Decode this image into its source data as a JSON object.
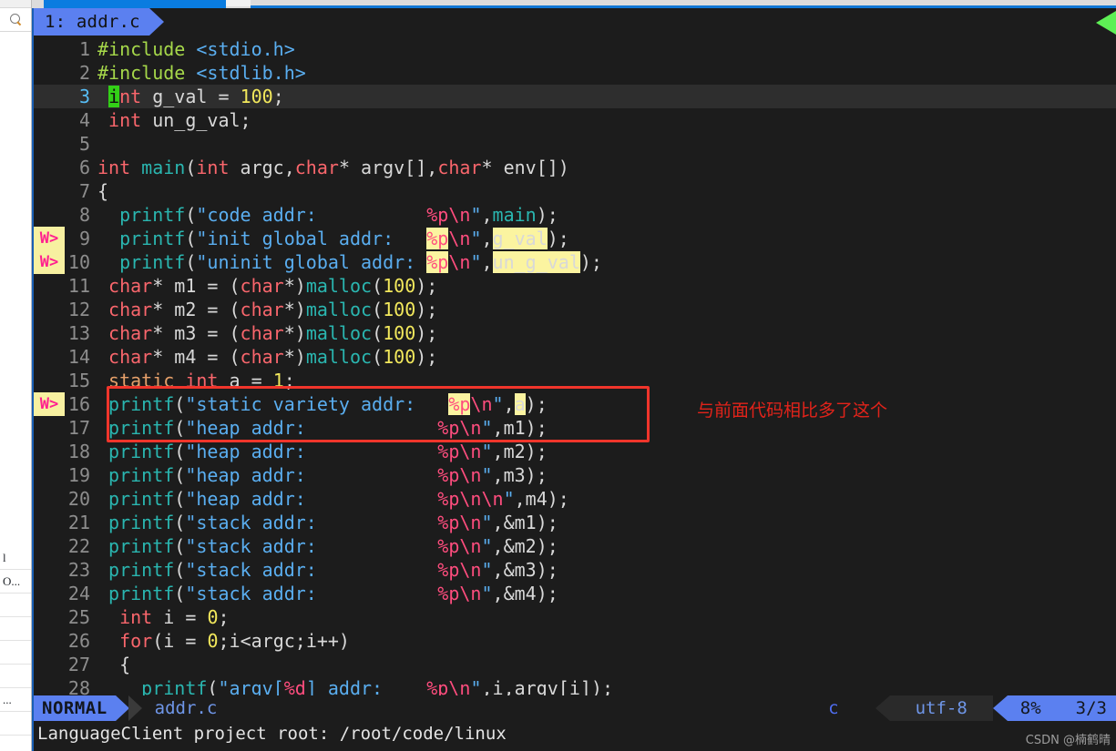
{
  "window": {
    "accent_blue": "#5b80f0",
    "editor_bg": "#1c1c1c",
    "annotation_red": "#e2231a",
    "warn_bg": "#f7f0a0",
    "warn_fg": "#ff1f8f",
    "highlight_bg": "#fbf4a0",
    "cursor_bg": "#33d017"
  },
  "left_panel": {
    "search_icon": "search-icon",
    "rows": [
      "",
      "l",
      "O...",
      "",
      "",
      "",
      "",
      "...",
      ""
    ]
  },
  "tabline": {
    "active_tab": "1: addr.c",
    "right_marker_icon": "green-arrow-icon"
  },
  "annotation": {
    "note_text": "与前面代码相比多了这个",
    "box_label": "red-highlight-box"
  },
  "statusline": {
    "mode": "NORMAL",
    "filename": "addr.c",
    "filetype": "c",
    "encoding": "utf-8",
    "percent": "8%",
    "ratio": "3/3"
  },
  "cmdline": {
    "message": "LanguageClient project root: /root/code/linux"
  },
  "watermark": {
    "text": "CSDN @楠鹤晴"
  },
  "code": {
    "lines": [
      {
        "n": "1",
        "sign": "",
        "current": false,
        "tokens": [
          {
            "t": "#include ",
            "c": "pp"
          },
          {
            "t": "<stdio.h>",
            "c": "hdr"
          }
        ]
      },
      {
        "n": "2",
        "sign": "",
        "current": false,
        "tokens": [
          {
            "t": "#include ",
            "c": "pp"
          },
          {
            "t": "<stdlib.h>",
            "c": "hdr"
          }
        ]
      },
      {
        "n": "3",
        "sign": "",
        "current": true,
        "tokens": [
          {
            "t": " ",
            "c": "pun"
          },
          {
            "t": "i",
            "c": "cursor"
          },
          {
            "t": "nt",
            "c": "k"
          },
          {
            "t": " g_val ",
            "c": "pun"
          },
          {
            "t": "= ",
            "c": "pun"
          },
          {
            "t": "100",
            "c": "num"
          },
          {
            "t": ";",
            "c": "pun"
          }
        ]
      },
      {
        "n": "4",
        "sign": "",
        "current": false,
        "tokens": [
          {
            "t": " ",
            "c": "pun"
          },
          {
            "t": "int",
            "c": "k"
          },
          {
            "t": " un_g_val;",
            "c": "pun"
          }
        ]
      },
      {
        "n": "5",
        "sign": "",
        "current": false,
        "tokens": []
      },
      {
        "n": "6",
        "sign": "",
        "current": false,
        "tokens": [
          {
            "t": "int",
            "c": "k"
          },
          {
            "t": " ",
            "c": "pun"
          },
          {
            "t": "main",
            "c": "fn"
          },
          {
            "t": "(",
            "c": "pun"
          },
          {
            "t": "int",
            "c": "k"
          },
          {
            "t": " argc,",
            "c": "pun"
          },
          {
            "t": "char",
            "c": "k"
          },
          {
            "t": "* argv[],",
            "c": "pun"
          },
          {
            "t": "char",
            "c": "k"
          },
          {
            "t": "* env[])",
            "c": "pun"
          }
        ]
      },
      {
        "n": "7",
        "sign": "",
        "current": false,
        "tokens": [
          {
            "t": "{",
            "c": "pun"
          }
        ]
      },
      {
        "n": "8",
        "sign": "",
        "current": false,
        "tokens": [
          {
            "t": "  ",
            "c": "pun"
          },
          {
            "t": "printf",
            "c": "fn"
          },
          {
            "t": "(",
            "c": "pun"
          },
          {
            "t": "\"code addr:          ",
            "c": "str"
          },
          {
            "t": "%p",
            "c": "esc"
          },
          {
            "t": "\\n",
            "c": "esc"
          },
          {
            "t": "\"",
            "c": "str"
          },
          {
            "t": ",",
            "c": "pun"
          },
          {
            "t": "main",
            "c": "fn"
          },
          {
            "t": ");",
            "c": "pun"
          }
        ]
      },
      {
        "n": "9",
        "sign": "W>",
        "current": false,
        "tokens": [
          {
            "t": "  ",
            "c": "pun"
          },
          {
            "t": "printf",
            "c": "fn"
          },
          {
            "t": "(",
            "c": "pun"
          },
          {
            "t": "\"init global addr:   ",
            "c": "str"
          },
          {
            "t": "%p",
            "c": "esc",
            "hl": true
          },
          {
            "t": "\\n",
            "c": "esc"
          },
          {
            "t": "\"",
            "c": "str"
          },
          {
            "t": ",",
            "c": "pun"
          },
          {
            "t": "g_val",
            "c": "pun",
            "hl": true
          },
          {
            "t": ");",
            "c": "pun"
          }
        ]
      },
      {
        "n": "10",
        "sign": "W>",
        "current": false,
        "tokens": [
          {
            "t": "  ",
            "c": "pun"
          },
          {
            "t": "printf",
            "c": "fn"
          },
          {
            "t": "(",
            "c": "pun"
          },
          {
            "t": "\"uninit global addr: ",
            "c": "str"
          },
          {
            "t": "%p",
            "c": "esc",
            "hl": true
          },
          {
            "t": "\\n",
            "c": "esc"
          },
          {
            "t": "\"",
            "c": "str"
          },
          {
            "t": ",",
            "c": "pun"
          },
          {
            "t": "un_g_val",
            "c": "pun",
            "hl": true
          },
          {
            "t": ");",
            "c": "pun"
          }
        ]
      },
      {
        "n": "11",
        "sign": "",
        "current": false,
        "tokens": [
          {
            "t": " ",
            "c": "pun"
          },
          {
            "t": "char",
            "c": "k"
          },
          {
            "t": "* m1 = (",
            "c": "pun"
          },
          {
            "t": "char",
            "c": "k"
          },
          {
            "t": "*)",
            "c": "pun"
          },
          {
            "t": "malloc",
            "c": "fn"
          },
          {
            "t": "(",
            "c": "pun"
          },
          {
            "t": "100",
            "c": "num"
          },
          {
            "t": ");",
            "c": "pun"
          }
        ]
      },
      {
        "n": "12",
        "sign": "",
        "current": false,
        "tokens": [
          {
            "t": " ",
            "c": "pun"
          },
          {
            "t": "char",
            "c": "k"
          },
          {
            "t": "* m2 = (",
            "c": "pun"
          },
          {
            "t": "char",
            "c": "k"
          },
          {
            "t": "*)",
            "c": "pun"
          },
          {
            "t": "malloc",
            "c": "fn"
          },
          {
            "t": "(",
            "c": "pun"
          },
          {
            "t": "100",
            "c": "num"
          },
          {
            "t": ");",
            "c": "pun"
          }
        ]
      },
      {
        "n": "13",
        "sign": "",
        "current": false,
        "tokens": [
          {
            "t": " ",
            "c": "pun"
          },
          {
            "t": "char",
            "c": "k"
          },
          {
            "t": "* m3 = (",
            "c": "pun"
          },
          {
            "t": "char",
            "c": "k"
          },
          {
            "t": "*)",
            "c": "pun"
          },
          {
            "t": "malloc",
            "c": "fn"
          },
          {
            "t": "(",
            "c": "pun"
          },
          {
            "t": "100",
            "c": "num"
          },
          {
            "t": ");",
            "c": "pun"
          }
        ]
      },
      {
        "n": "14",
        "sign": "",
        "current": false,
        "tokens": [
          {
            "t": " ",
            "c": "pun"
          },
          {
            "t": "char",
            "c": "k"
          },
          {
            "t": "* m4 = (",
            "c": "pun"
          },
          {
            "t": "char",
            "c": "k"
          },
          {
            "t": "*)",
            "c": "pun"
          },
          {
            "t": "malloc",
            "c": "fn"
          },
          {
            "t": "(",
            "c": "pun"
          },
          {
            "t": "100",
            "c": "num"
          },
          {
            "t": ");",
            "c": "pun"
          }
        ]
      },
      {
        "n": "15",
        "sign": "",
        "current": false,
        "tokens": [
          {
            "t": " ",
            "c": "pun"
          },
          {
            "t": "static",
            "c": "kw2"
          },
          {
            "t": " ",
            "c": "pun"
          },
          {
            "t": "int",
            "c": "k"
          },
          {
            "t": " a = ",
            "c": "pun"
          },
          {
            "t": "1",
            "c": "num"
          },
          {
            "t": ";",
            "c": "pun"
          }
        ]
      },
      {
        "n": "16",
        "sign": "W>",
        "current": false,
        "tokens": [
          {
            "t": " ",
            "c": "pun"
          },
          {
            "t": "printf",
            "c": "fn"
          },
          {
            "t": "(",
            "c": "pun"
          },
          {
            "t": "\"static variety addr:   ",
            "c": "str"
          },
          {
            "t": "%p",
            "c": "esc",
            "hl": true
          },
          {
            "t": "\\n",
            "c": "esc"
          },
          {
            "t": "\"",
            "c": "str"
          },
          {
            "t": ",",
            "c": "pun"
          },
          {
            "t": "a",
            "c": "pun",
            "hl": true
          },
          {
            "t": ");",
            "c": "pun"
          }
        ]
      },
      {
        "n": "17",
        "sign": "",
        "current": false,
        "tokens": [
          {
            "t": " ",
            "c": "pun"
          },
          {
            "t": "printf",
            "c": "fn"
          },
          {
            "t": "(",
            "c": "pun"
          },
          {
            "t": "\"heap addr:            ",
            "c": "str"
          },
          {
            "t": "%p",
            "c": "esc"
          },
          {
            "t": "\\n",
            "c": "esc"
          },
          {
            "t": "\"",
            "c": "str"
          },
          {
            "t": ",m1);",
            "c": "pun"
          }
        ]
      },
      {
        "n": "18",
        "sign": "",
        "current": false,
        "tokens": [
          {
            "t": " ",
            "c": "pun"
          },
          {
            "t": "printf",
            "c": "fn"
          },
          {
            "t": "(",
            "c": "pun"
          },
          {
            "t": "\"heap addr:            ",
            "c": "str"
          },
          {
            "t": "%p",
            "c": "esc"
          },
          {
            "t": "\\n",
            "c": "esc"
          },
          {
            "t": "\"",
            "c": "str"
          },
          {
            "t": ",m2);",
            "c": "pun"
          }
        ]
      },
      {
        "n": "19",
        "sign": "",
        "current": false,
        "tokens": [
          {
            "t": " ",
            "c": "pun"
          },
          {
            "t": "printf",
            "c": "fn"
          },
          {
            "t": "(",
            "c": "pun"
          },
          {
            "t": "\"heap addr:            ",
            "c": "str"
          },
          {
            "t": "%p",
            "c": "esc"
          },
          {
            "t": "\\n",
            "c": "esc"
          },
          {
            "t": "\"",
            "c": "str"
          },
          {
            "t": ",m3);",
            "c": "pun"
          }
        ]
      },
      {
        "n": "20",
        "sign": "",
        "current": false,
        "tokens": [
          {
            "t": " ",
            "c": "pun"
          },
          {
            "t": "printf",
            "c": "fn"
          },
          {
            "t": "(",
            "c": "pun"
          },
          {
            "t": "\"heap addr:            ",
            "c": "str"
          },
          {
            "t": "%p",
            "c": "esc"
          },
          {
            "t": "\\n\\n",
            "c": "esc"
          },
          {
            "t": "\"",
            "c": "str"
          },
          {
            "t": ",m4);",
            "c": "pun"
          }
        ]
      },
      {
        "n": "21",
        "sign": "",
        "current": false,
        "tokens": [
          {
            "t": " ",
            "c": "pun"
          },
          {
            "t": "printf",
            "c": "fn"
          },
          {
            "t": "(",
            "c": "pun"
          },
          {
            "t": "\"stack addr:           ",
            "c": "str"
          },
          {
            "t": "%p",
            "c": "esc"
          },
          {
            "t": "\\n",
            "c": "esc"
          },
          {
            "t": "\"",
            "c": "str"
          },
          {
            "t": ",&m1);",
            "c": "pun"
          }
        ]
      },
      {
        "n": "22",
        "sign": "",
        "current": false,
        "tokens": [
          {
            "t": " ",
            "c": "pun"
          },
          {
            "t": "printf",
            "c": "fn"
          },
          {
            "t": "(",
            "c": "pun"
          },
          {
            "t": "\"stack addr:           ",
            "c": "str"
          },
          {
            "t": "%p",
            "c": "esc"
          },
          {
            "t": "\\n",
            "c": "esc"
          },
          {
            "t": "\"",
            "c": "str"
          },
          {
            "t": ",&m2);",
            "c": "pun"
          }
        ]
      },
      {
        "n": "23",
        "sign": "",
        "current": false,
        "tokens": [
          {
            "t": " ",
            "c": "pun"
          },
          {
            "t": "printf",
            "c": "fn"
          },
          {
            "t": "(",
            "c": "pun"
          },
          {
            "t": "\"stack addr:           ",
            "c": "str"
          },
          {
            "t": "%p",
            "c": "esc"
          },
          {
            "t": "\\n",
            "c": "esc"
          },
          {
            "t": "\"",
            "c": "str"
          },
          {
            "t": ",&m3);",
            "c": "pun"
          }
        ]
      },
      {
        "n": "24",
        "sign": "",
        "current": false,
        "tokens": [
          {
            "t": " ",
            "c": "pun"
          },
          {
            "t": "printf",
            "c": "fn"
          },
          {
            "t": "(",
            "c": "pun"
          },
          {
            "t": "\"stack addr:           ",
            "c": "str"
          },
          {
            "t": "%p",
            "c": "esc"
          },
          {
            "t": "\\n",
            "c": "esc"
          },
          {
            "t": "\"",
            "c": "str"
          },
          {
            "t": ",&m4);",
            "c": "pun"
          }
        ]
      },
      {
        "n": "25",
        "sign": "",
        "current": false,
        "tokens": [
          {
            "t": "  ",
            "c": "pun"
          },
          {
            "t": "int",
            "c": "k"
          },
          {
            "t": " i = ",
            "c": "pun"
          },
          {
            "t": "0",
            "c": "num"
          },
          {
            "t": ";",
            "c": "pun"
          }
        ]
      },
      {
        "n": "26",
        "sign": "",
        "current": false,
        "tokens": [
          {
            "t": "  ",
            "c": "pun"
          },
          {
            "t": "for",
            "c": "k"
          },
          {
            "t": "(i = ",
            "c": "pun"
          },
          {
            "t": "0",
            "c": "num"
          },
          {
            "t": ";i<argc;i++)",
            "c": "pun"
          }
        ]
      },
      {
        "n": "27",
        "sign": "",
        "current": false,
        "tokens": [
          {
            "t": "  {",
            "c": "pun"
          }
        ]
      },
      {
        "n": "28",
        "sign": "",
        "current": false,
        "tokens": [
          {
            "t": "    ",
            "c": "pun"
          },
          {
            "t": "printf",
            "c": "fn"
          },
          {
            "t": "(",
            "c": "pun"
          },
          {
            "t": "\"argv[",
            "c": "str"
          },
          {
            "t": "%d",
            "c": "esc"
          },
          {
            "t": "] addr:    ",
            "c": "str"
          },
          {
            "t": "%p",
            "c": "esc"
          },
          {
            "t": "\\n",
            "c": "esc"
          },
          {
            "t": "\"",
            "c": "str"
          },
          {
            "t": ",i,argv[i]);",
            "c": "pun"
          }
        ]
      }
    ]
  }
}
